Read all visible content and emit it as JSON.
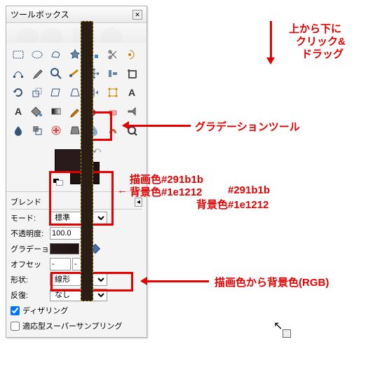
{
  "window": {
    "title": "ツールボックス",
    "close": "✕"
  },
  "tool_names": [
    "rect-select",
    "ellipse-select",
    "free-select",
    "fuzzy-select",
    "color-select",
    "scissors",
    "foreground-select",
    "paths",
    "color-picker",
    "zoom",
    "measure",
    "move",
    "align",
    "crop",
    "rotate",
    "scale",
    "shear",
    "perspective",
    "flip",
    "cage",
    "text-tool",
    "text",
    "bucket-fill",
    "gradient",
    "pencil",
    "paintbrush",
    "eraser",
    "airbrush",
    "ink",
    "clone",
    "heal",
    "perspective-clone",
    "blur",
    "smudge",
    "dodge"
  ],
  "options": {
    "header": "ブレンド",
    "mode_label": "モード:",
    "mode_value": "標準",
    "opacity_label": "不透明度:",
    "opacity_value": "100.0",
    "gradient_label": "グラデー",
    "gradient_label2": "ョン:",
    "offset_label": "オフセッ",
    "offset_value": "-",
    "offset_value2": "-",
    "shape_label": "形状:",
    "shape_value": "線形",
    "repeat_label": "反復:",
    "repeat_value": "なし",
    "dither_label": "ディザリング",
    "supersample_label": "適応型スーパーサンプリング"
  },
  "annotations": {
    "drag_hint_1": "上から下に",
    "drag_hint_2": "クリック&",
    "drag_hint_3": "ドラッグ",
    "gradient_tool": "グラデーションツール",
    "fg_label": "描画色#291b1b",
    "bg_label": "背景色#1e1212",
    "fg_label2": "#291b1b",
    "bg_label2": "背景色#1e1212",
    "grad_note": "描画色から背景色(RGB)"
  },
  "colors": {
    "fg": "#291b1b",
    "bg": "#1e1212",
    "accent": "#e60000"
  }
}
